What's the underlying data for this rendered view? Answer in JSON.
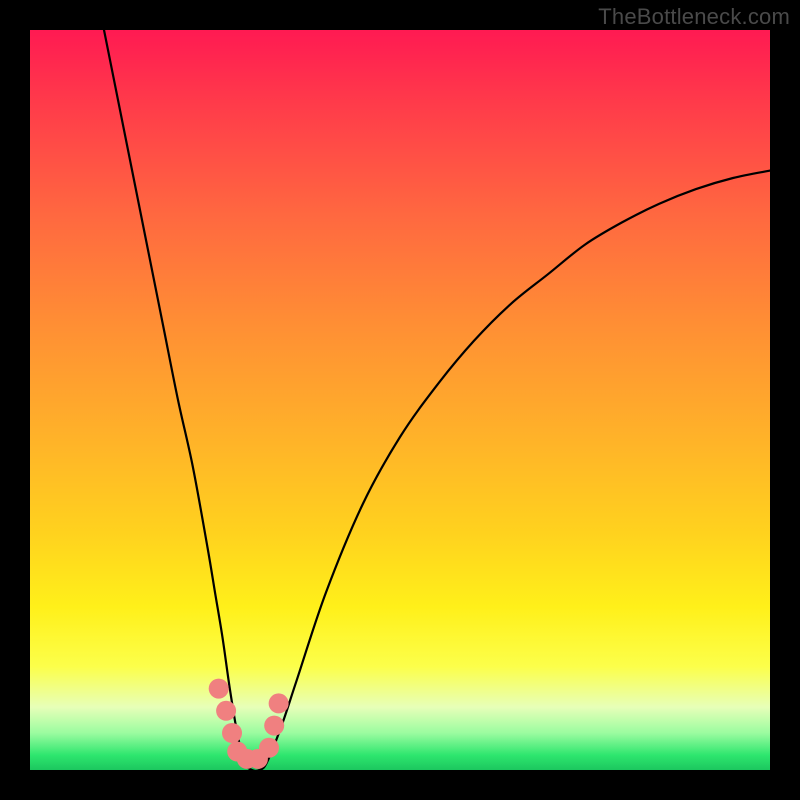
{
  "watermark": "TheBottleneck.com",
  "chart_data": {
    "type": "line",
    "title": "",
    "xlabel": "",
    "ylabel": "",
    "xlim": [
      0,
      100
    ],
    "ylim": [
      0,
      100
    ],
    "series": [
      {
        "name": "bottleneck-curve",
        "x": [
          10,
          12,
          14,
          16,
          18,
          20,
          22,
          24,
          25,
          26,
          27,
          28,
          29,
          30,
          31,
          32,
          34,
          36,
          40,
          45,
          50,
          55,
          60,
          65,
          70,
          75,
          80,
          85,
          90,
          95,
          100
        ],
        "y": [
          100,
          90,
          80,
          70,
          60,
          50,
          41,
          30,
          24,
          18,
          11,
          5,
          1,
          0,
          0,
          1,
          6,
          12,
          24,
          36,
          45,
          52,
          58,
          63,
          67,
          71,
          74,
          76.5,
          78.5,
          80,
          81
        ]
      }
    ],
    "markers": {
      "name": "highlight-dots",
      "color": "#f08080",
      "points": [
        {
          "x": 25.5,
          "y": 11
        },
        {
          "x": 26.5,
          "y": 8
        },
        {
          "x": 27.3,
          "y": 5
        },
        {
          "x": 28.0,
          "y": 2.5
        },
        {
          "x": 29.3,
          "y": 1.5
        },
        {
          "x": 30.8,
          "y": 1.5
        },
        {
          "x": 32.3,
          "y": 3
        },
        {
          "x": 33.0,
          "y": 6
        },
        {
          "x": 33.6,
          "y": 9
        }
      ]
    },
    "gradient_stops": [
      {
        "pos": 0,
        "color": "#ff1a52"
      },
      {
        "pos": 55,
        "color": "#ffb229"
      },
      {
        "pos": 86,
        "color": "#fcff4a"
      },
      {
        "pos": 100,
        "color": "#1cc75f"
      }
    ]
  }
}
